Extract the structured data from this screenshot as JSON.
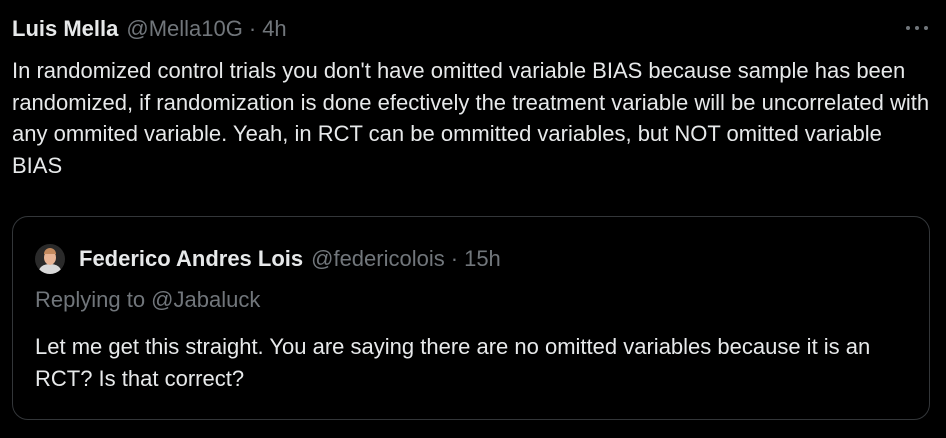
{
  "tweet": {
    "author_name": "Luis Mella",
    "author_handle": "@Mella10G",
    "separator": "·",
    "time": "4h",
    "more_icon": "ellipsis-icon",
    "text": "In randomized control trials you don't have omitted variable BIAS because sample has been randomized, if randomization is done efectively the treatment variable  will be uncorrelated with any ommited variable. Yeah, in RCT can be ommitted variables, but NOT omitted variable BIAS"
  },
  "quoted_tweet": {
    "author_name": "Federico Andres Lois",
    "author_handle": "@federicolois",
    "separator": "·",
    "time": "15h",
    "replying_to": "Replying to @Jabaluck",
    "text": "Let me get this straight. You are saying there are no omitted variables because it is an RCT? Is that correct?"
  },
  "colors": {
    "background": "#000000",
    "primary_text": "#e7e9ea",
    "secondary_text": "#71767b",
    "border": "#333639"
  }
}
